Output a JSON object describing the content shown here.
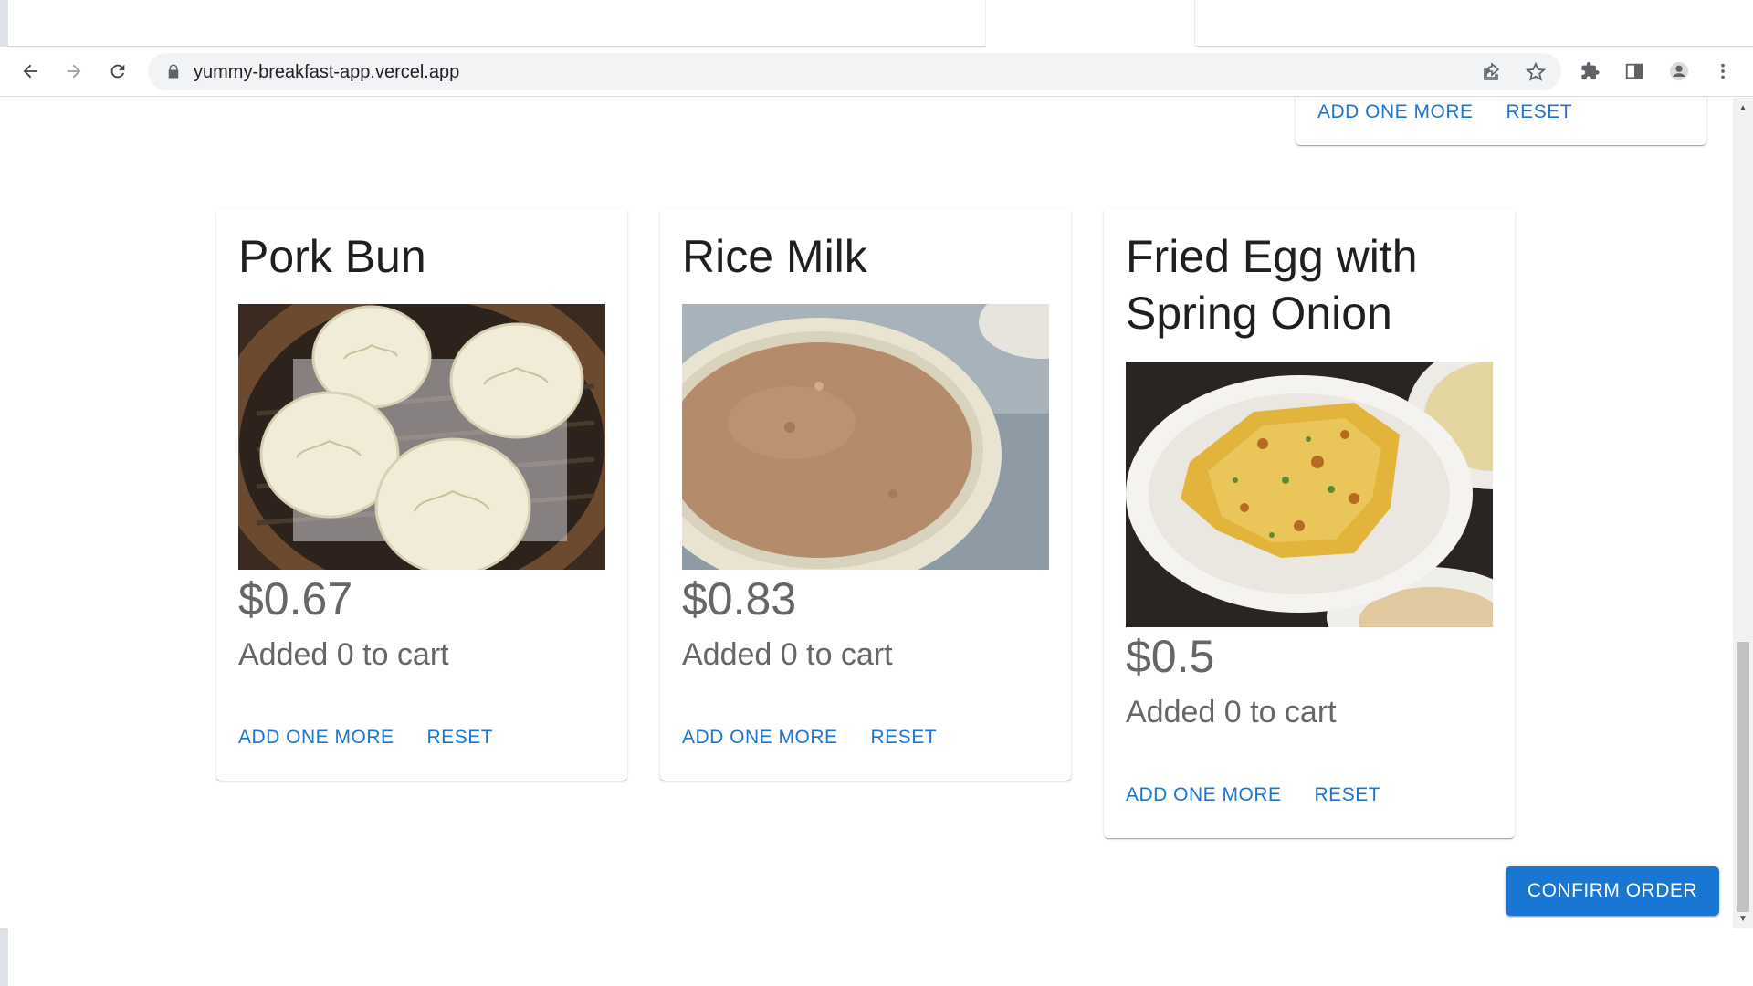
{
  "browser": {
    "url": "yummy-breakfast-app.vercel.app",
    "icons": [
      "back-icon",
      "forward-icon",
      "reload-icon",
      "lock-icon",
      "share-icon",
      "star-icon",
      "extensions-icon",
      "side-panel-icon",
      "profile-icon",
      "menu-icon"
    ]
  },
  "top_card": {
    "add_label": "ADD ONE MORE",
    "reset_label": "RESET"
  },
  "products": [
    {
      "name": "Pork Bun",
      "price": "$0.67",
      "cart_text": "Added 0 to cart",
      "add_label": "ADD ONE MORE",
      "reset_label": "RESET"
    },
    {
      "name": "Rice Milk",
      "price": "$0.83",
      "cart_text": "Added 0 to cart",
      "add_label": "ADD ONE MORE",
      "reset_label": "RESET"
    },
    {
      "name": "Fried Egg with Spring Onion",
      "price": "$0.5",
      "cart_text": "Added 0 to cart",
      "add_label": "ADD ONE MORE",
      "reset_label": "RESET"
    }
  ],
  "confirm_label": "CONFIRM ORDER",
  "colors": {
    "primary": "#1976d2",
    "title": "#1f1f1f",
    "secondary_text": "#666666"
  }
}
